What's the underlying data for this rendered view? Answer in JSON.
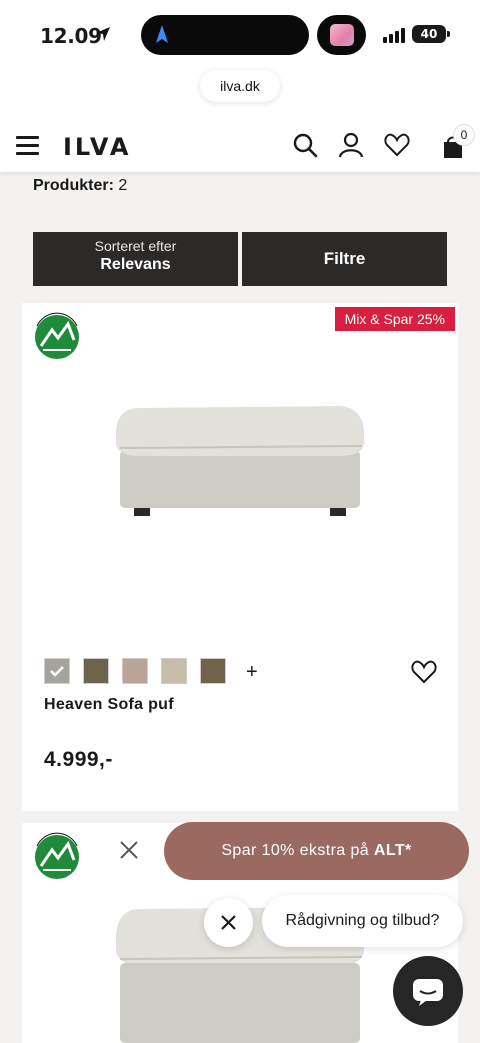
{
  "status_bar": {
    "time": "12.09",
    "battery": "40"
  },
  "browser": {
    "url": "ilva.dk"
  },
  "header": {
    "logo": "ILVA",
    "cart_count": "0"
  },
  "listing": {
    "count_label": "Produkter:",
    "count_value": "2"
  },
  "sort": {
    "label": "Sorteret efter",
    "value": "Relevans"
  },
  "filter": {
    "label": "Filtre"
  },
  "products": [
    {
      "badge": "Mix & Spar 25%",
      "name": "Heaven Sofa puf",
      "price": "4.999,-",
      "swatches": [
        "#a5a39d",
        "#6d6450",
        "#b9a598",
        "#c7bda9",
        "#6f6449"
      ],
      "selected_swatch": 0,
      "more_colors": "+"
    }
  ],
  "promo_banner": {
    "text": "Spar 10% ekstra på ",
    "bold": "ALT*"
  },
  "chat": {
    "label": "Rådgivning og tilbud?"
  },
  "colors": {
    "button_dark": "#2c2a29",
    "badge_red": "#d81f3f",
    "promo_brown": "#9a6a60",
    "eco_green": "#1f8a3a"
  },
  "icons": [
    "location-arrow-icon",
    "hamburger-menu-icon",
    "search-icon",
    "user-icon",
    "heart-icon",
    "shopping-bag-icon",
    "swan-ecolabel-icon",
    "close-icon",
    "chat-icon",
    "check-icon"
  ]
}
